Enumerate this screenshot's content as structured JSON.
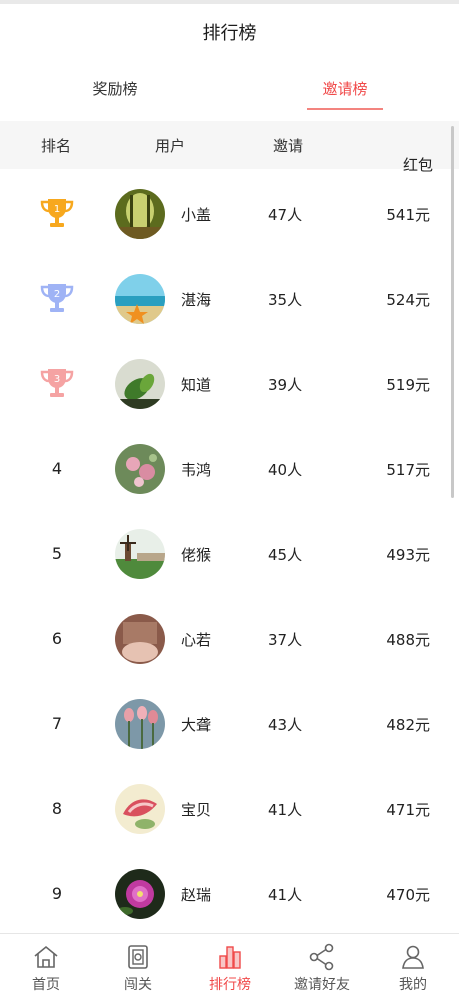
{
  "header": {
    "title": "排行榜"
  },
  "tabs": {
    "reward": "奖励榜",
    "invite": "邀请榜",
    "active": "invite"
  },
  "columns": {
    "rank": "排名",
    "user": "用户",
    "invite": "邀请",
    "bonus": "红包"
  },
  "colors": {
    "accent": "#f04a4a",
    "gold": "#f7a81e",
    "silver": "#9fb3f5",
    "bronze": "#f5a3a3"
  },
  "rows": [
    {
      "rank": "1",
      "name": "小盖",
      "invites": "47人",
      "bonus": "541元",
      "badge": "trophy-gold"
    },
    {
      "rank": "2",
      "name": "湛海",
      "invites": "35人",
      "bonus": "524元",
      "badge": "trophy-silver"
    },
    {
      "rank": "3",
      "name": "知道",
      "invites": "39人",
      "bonus": "519元",
      "badge": "trophy-bronze"
    },
    {
      "rank": "4",
      "name": "韦鸿",
      "invites": "40人",
      "bonus": "517元"
    },
    {
      "rank": "5",
      "name": "佬猴",
      "invites": "45人",
      "bonus": "493元"
    },
    {
      "rank": "6",
      "name": "心若",
      "invites": "37人",
      "bonus": "488元"
    },
    {
      "rank": "7",
      "name": "大聋",
      "invites": "43人",
      "bonus": "482元"
    },
    {
      "rank": "8",
      "name": "宝贝",
      "invites": "41人",
      "bonus": "471元"
    },
    {
      "rank": "9",
      "name": "赵瑞",
      "invites": "41人",
      "bonus": "470元"
    }
  ],
  "tabbar": {
    "items": [
      {
        "label": "首页",
        "icon": "home-icon"
      },
      {
        "label": "闯关",
        "icon": "level-icon"
      },
      {
        "label": "排行榜",
        "icon": "ranking-icon",
        "active": true
      },
      {
        "label": "邀请好友",
        "icon": "share-icon"
      },
      {
        "label": "我的",
        "icon": "user-icon"
      }
    ]
  }
}
